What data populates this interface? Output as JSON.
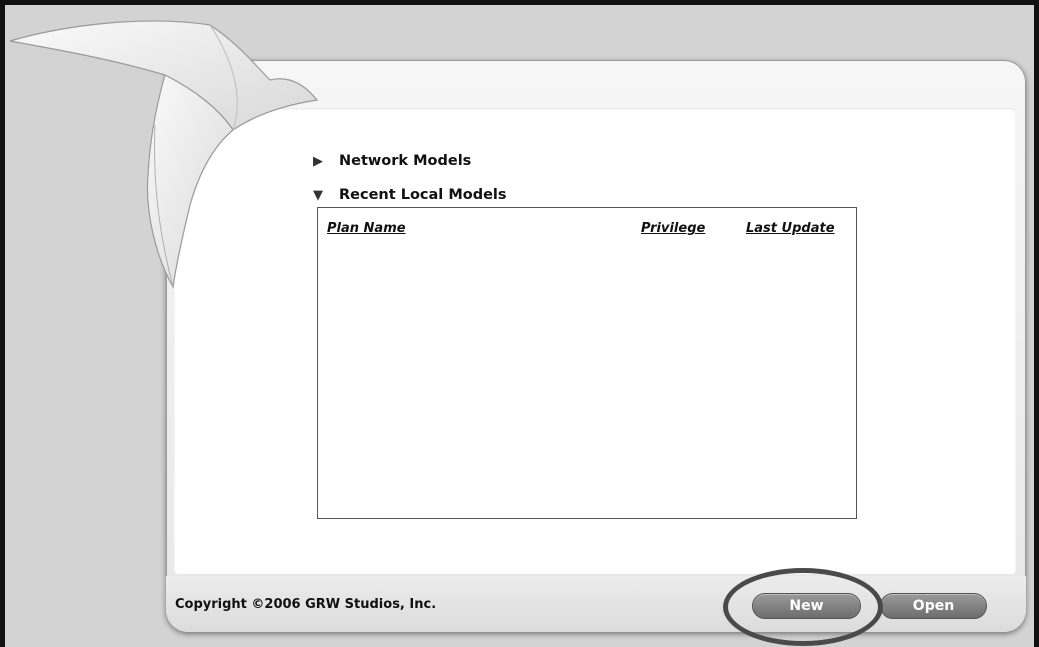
{
  "sections": {
    "network": {
      "label": "Network Models",
      "icon": "triangle-right-icon",
      "expanded": false
    },
    "recent": {
      "label": "Recent Local Models",
      "icon": "triangle-down-icon",
      "expanded": true
    }
  },
  "table": {
    "columns": [
      "Plan Name",
      "Privilege",
      "Last Update"
    ],
    "rows": []
  },
  "footer": {
    "copyright": "Copyright ©2006  GRW Studios, Inc.",
    "new_label": "New",
    "open_label": "Open"
  },
  "colors": {
    "background": "#d3d3d3",
    "button": "#808080",
    "highlight_ring": "#4a4a4a"
  }
}
